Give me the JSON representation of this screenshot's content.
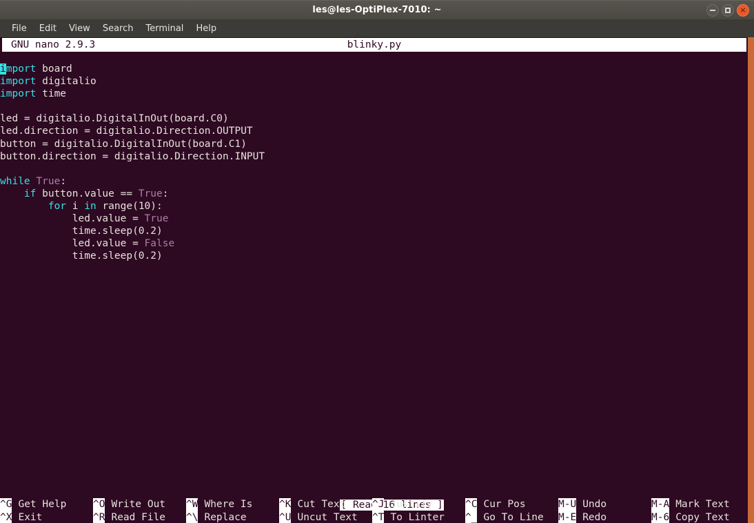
{
  "window": {
    "title": "les@les-OptiPlex-7010: ~",
    "buttons": {
      "minimize": "minimize",
      "maximize": "maximize",
      "close": "×"
    }
  },
  "menubar": {
    "items": [
      {
        "label": "File"
      },
      {
        "label": "Edit"
      },
      {
        "label": "View"
      },
      {
        "label": "Search"
      },
      {
        "label": "Terminal"
      },
      {
        "label": "Help"
      }
    ]
  },
  "editor": {
    "app_version": "GNU nano 2.9.3",
    "filename": "blinky.py",
    "status_message": "[ Read 16 lines ]",
    "cursor_char": "i",
    "code_lines": [
      {
        "indent": "",
        "tokens": [
          {
            "t": "import",
            "c": "kw"
          },
          {
            "t": " board",
            "c": "plain"
          }
        ]
      },
      {
        "indent": "",
        "tokens": [
          {
            "t": "import",
            "c": "kw"
          },
          {
            "t": " digitalio",
            "c": "plain"
          }
        ]
      },
      {
        "indent": "",
        "tokens": [
          {
            "t": "import",
            "c": "kw"
          },
          {
            "t": " time",
            "c": "plain"
          }
        ]
      },
      {
        "indent": "",
        "tokens": []
      },
      {
        "indent": "",
        "tokens": [
          {
            "t": "led = digitalio.DigitalInOut(board.C0)",
            "c": "plain"
          }
        ]
      },
      {
        "indent": "",
        "tokens": [
          {
            "t": "led.direction = digitalio.Direction.OUTPUT",
            "c": "plain"
          }
        ]
      },
      {
        "indent": "",
        "tokens": [
          {
            "t": "button = digitalio.DigitalInOut(board.C1)",
            "c": "plain"
          }
        ]
      },
      {
        "indent": "",
        "tokens": [
          {
            "t": "button.direction = digitalio.Direction.INPUT",
            "c": "plain"
          }
        ]
      },
      {
        "indent": "",
        "tokens": []
      },
      {
        "indent": "",
        "tokens": [
          {
            "t": "while",
            "c": "kw"
          },
          {
            "t": " ",
            "c": "plain"
          },
          {
            "t": "True",
            "c": "cst"
          },
          {
            "t": ":",
            "c": "plain"
          }
        ]
      },
      {
        "indent": "    ",
        "tokens": [
          {
            "t": "if",
            "c": "kw"
          },
          {
            "t": " button.value == ",
            "c": "plain"
          },
          {
            "t": "True",
            "c": "cst"
          },
          {
            "t": ":",
            "c": "plain"
          }
        ]
      },
      {
        "indent": "        ",
        "tokens": [
          {
            "t": "for",
            "c": "kw"
          },
          {
            "t": " i ",
            "c": "plain"
          },
          {
            "t": "in",
            "c": "kw"
          },
          {
            "t": " range(10):",
            "c": "plain"
          }
        ]
      },
      {
        "indent": "            ",
        "tokens": [
          {
            "t": "led.value = ",
            "c": "plain"
          },
          {
            "t": "True",
            "c": "cst"
          }
        ]
      },
      {
        "indent": "            ",
        "tokens": [
          {
            "t": "time.sleep(0.2)",
            "c": "plain"
          }
        ]
      },
      {
        "indent": "            ",
        "tokens": [
          {
            "t": "led.value = ",
            "c": "plain"
          },
          {
            "t": "False",
            "c": "cst"
          }
        ]
      },
      {
        "indent": "            ",
        "tokens": [
          {
            "t": "time.sleep(0.2)",
            "c": "plain"
          }
        ]
      }
    ],
    "help_rows": [
      [
        {
          "key": "^G",
          "label": "Get Help"
        },
        {
          "key": "^O",
          "label": "Write Out"
        },
        {
          "key": "^W",
          "label": "Where Is"
        },
        {
          "key": "^K",
          "label": "Cut Text"
        },
        {
          "key": "^J",
          "label": "Justify"
        },
        {
          "key": "^C",
          "label": "Cur Pos"
        },
        {
          "key": "M-U",
          "label": "Undo"
        },
        {
          "key": "M-A",
          "label": "Mark Text"
        }
      ],
      [
        {
          "key": "^X",
          "label": "Exit"
        },
        {
          "key": "^R",
          "label": "Read File"
        },
        {
          "key": "^\\",
          "label": "Replace"
        },
        {
          "key": "^U",
          "label": "Uncut Text"
        },
        {
          "key": "^T",
          "label": "To Linter"
        },
        {
          "key": "^_",
          "label": "Go To Line"
        },
        {
          "key": "M-E",
          "label": "Redo"
        },
        {
          "key": "M-6",
          "label": "Copy Text"
        }
      ]
    ]
  },
  "colors": {
    "terminal_bg": "#2d0922",
    "titlebar_bg": "#4a4841",
    "menubar_bg": "#3c3b37",
    "foreground": "#e8e3dc",
    "keyword": "#34e2e2",
    "constant": "#ad7fa8",
    "close_button": "#e8582b",
    "scrollbar": "#c96a38"
  }
}
